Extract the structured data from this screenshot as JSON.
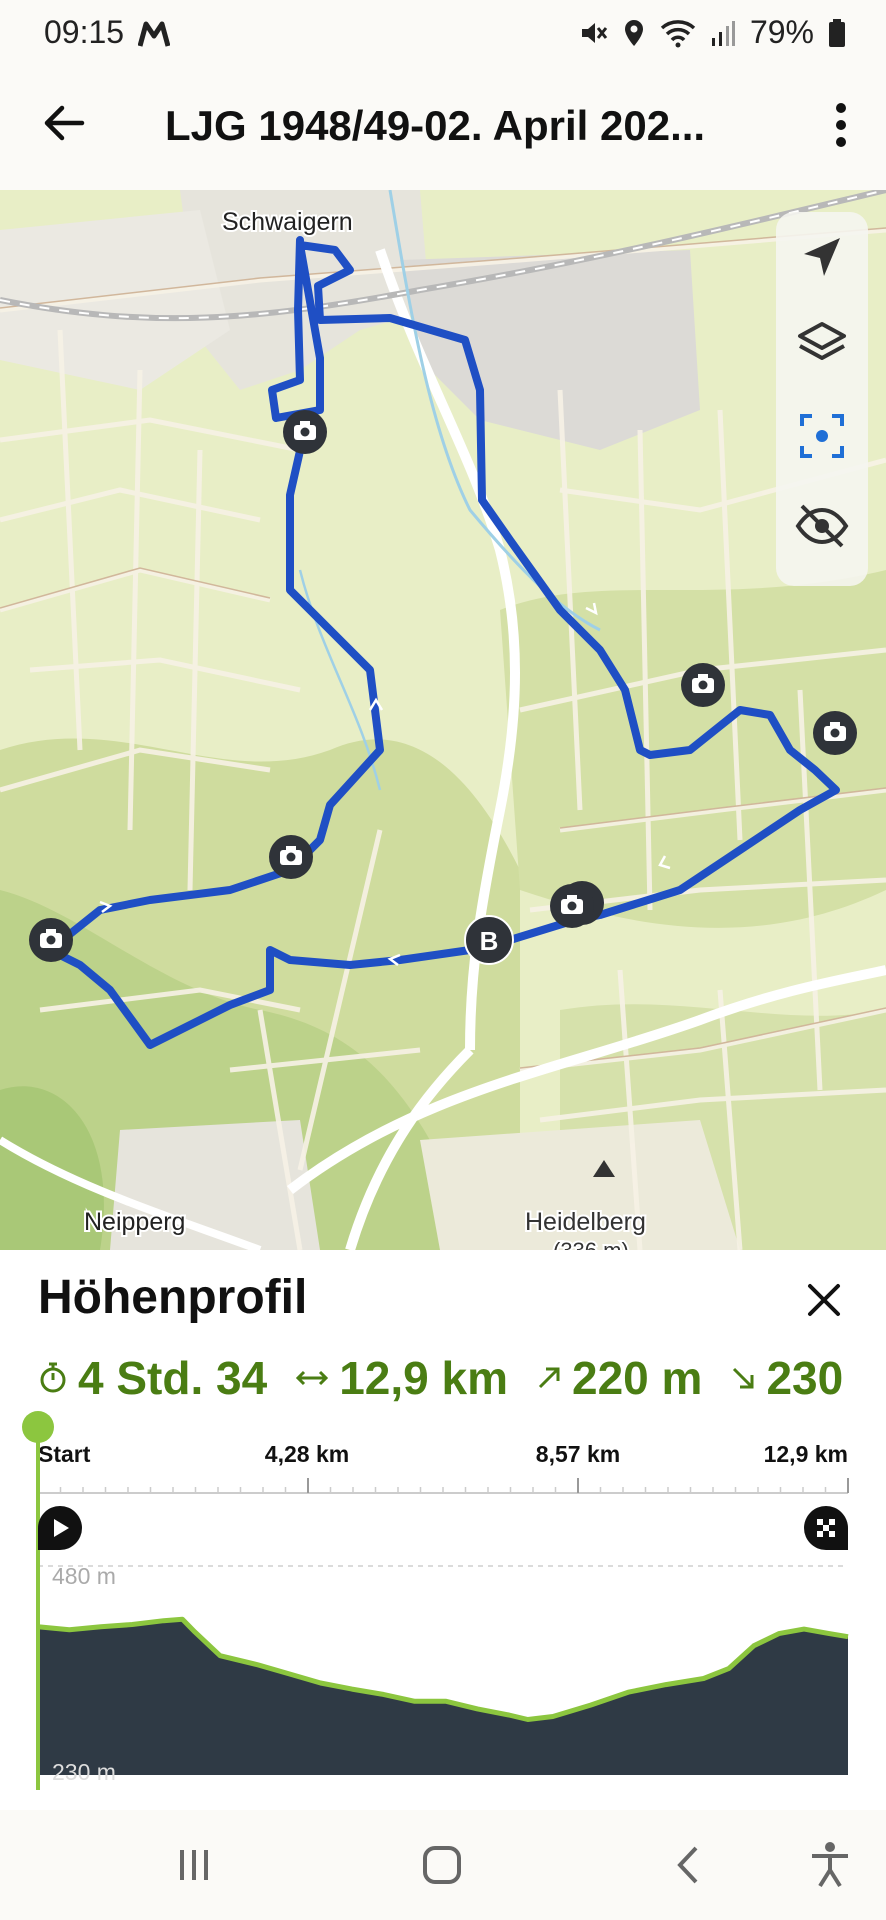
{
  "status_bar": {
    "time": "09:15",
    "battery": "79%",
    "icons": [
      "app-m-icon",
      "mute-icon",
      "location-icon",
      "wifi-icon",
      "signal-icon",
      "battery-icon"
    ]
  },
  "app_bar": {
    "title": "LJG 1948/49-02. April  202...",
    "back_icon": "arrow-left-icon",
    "menu_icon": "more-vertical-icon"
  },
  "map": {
    "labels": {
      "town_north": "Schwaigern",
      "town_southwest": "Neipperg",
      "peak": "Heidelberg",
      "peak_elevation": "(336 m)"
    },
    "marker_b": "B",
    "route_color": "#1f4fc4",
    "controls": [
      "navigate-icon",
      "layers-icon",
      "focus-icon",
      "visibility-off-icon"
    ]
  },
  "elevation": {
    "title": "Höhenprofil",
    "stats": {
      "duration": "4 Std. 34",
      "distance": "12,9 km",
      "ascent": "220 m",
      "descent": "230"
    },
    "accent_color": "#4a7d13",
    "axis_labels": [
      "Start",
      "4,28 km",
      "8,57 km",
      "12,9 km"
    ],
    "y_labels": {
      "top": "480 m",
      "bottom": "230 m"
    }
  },
  "chart_data": {
    "type": "area",
    "xlabel": "",
    "ylabel": "",
    "xlim": [
      0,
      12.9
    ],
    "ylim": [
      230,
      480
    ],
    "x_tick_labels": [
      "Start",
      "4,28 km",
      "8,57 km",
      "12,9 km"
    ],
    "y_tick_labels": [
      "480 m",
      "230 m"
    ],
    "x": [
      0,
      0.5,
      1.0,
      1.5,
      2.0,
      2.3,
      2.5,
      2.9,
      3.5,
      4.0,
      4.5,
      5.0,
      5.5,
      6.0,
      6.5,
      7.0,
      7.5,
      7.8,
      8.2,
      8.8,
      9.4,
      10.0,
      10.6,
      11.0,
      11.4,
      11.8,
      12.2,
      12.6,
      12.9
    ],
    "y": [
      400,
      396,
      400,
      403,
      408,
      410,
      393,
      362,
      350,
      338,
      326,
      318,
      311,
      302,
      302,
      292,
      284,
      278,
      282,
      297,
      314,
      324,
      332,
      345,
      375,
      391,
      397,
      391,
      387
    ],
    "markers": [
      "start-flag-icon",
      "finish-flag-icon"
    ]
  },
  "nav_bar": {
    "icons": [
      "recent-apps-icon",
      "home-icon",
      "back-icon",
      "accessibility-icon"
    ]
  }
}
